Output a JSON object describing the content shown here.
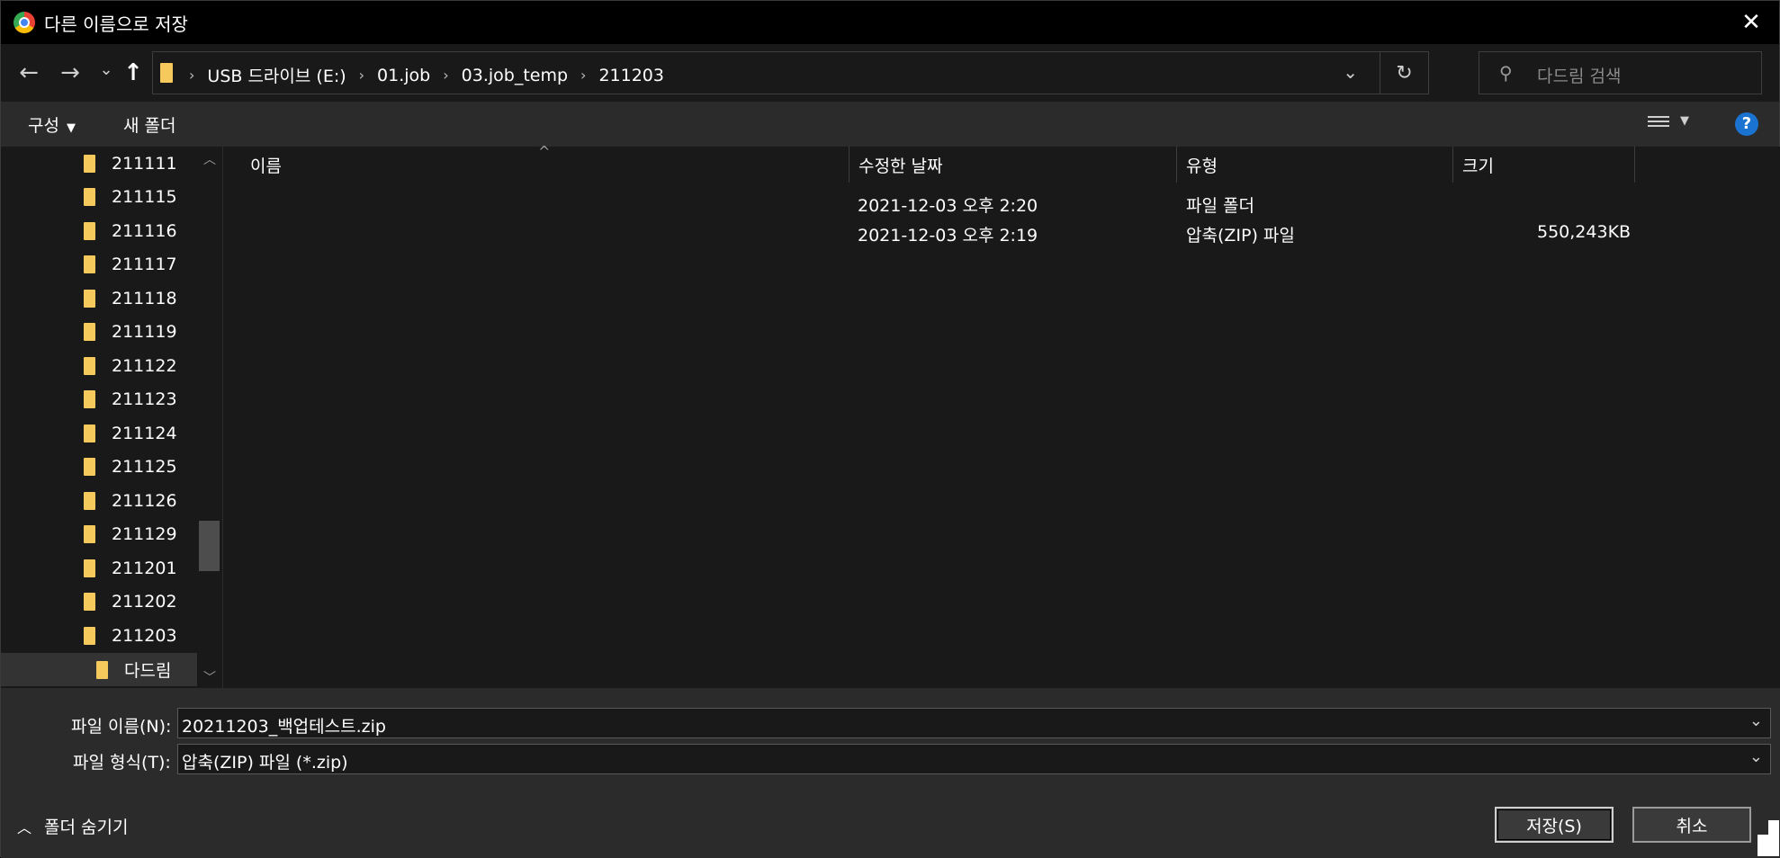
{
  "window": {
    "title": "다른 이름으로 저장",
    "close_glyph": "✕"
  },
  "nav": {
    "back_glyph": "←",
    "forward_glyph": "→",
    "recent_glyph": "⌄",
    "up_glyph": "↑",
    "breadcrumbs": [
      "USB 드라이브 (E:)",
      "01.job",
      "03.job_temp",
      "211203"
    ],
    "separator": "›",
    "dropdown_glyph": "⌄",
    "refresh_glyph": "↻",
    "search_placeholder": "다드림 검색"
  },
  "toolbar": {
    "organize_label": "구성",
    "new_folder_label": "새 폴더",
    "help_label": "?"
  },
  "sidebar": {
    "items": [
      {
        "label": "211111"
      },
      {
        "label": "211115"
      },
      {
        "label": "211116"
      },
      {
        "label": "211117"
      },
      {
        "label": "211118"
      },
      {
        "label": "211119"
      },
      {
        "label": "211122"
      },
      {
        "label": "211123"
      },
      {
        "label": "211124"
      },
      {
        "label": "211125"
      },
      {
        "label": "211126"
      },
      {
        "label": "211129"
      },
      {
        "label": "211201"
      },
      {
        "label": "211202"
      },
      {
        "label": "211203"
      },
      {
        "label": "다드림"
      }
    ],
    "selected_label": "다드림"
  },
  "files": {
    "columns": {
      "name": "이름",
      "modified": "수정한 날짜",
      "type": "유형",
      "size": "크기"
    },
    "rows": [
      {
        "name": "",
        "modified": "2021-12-03 오후 2:20",
        "type": "파일 폴더",
        "size": ""
      },
      {
        "name": "",
        "modified": "2021-12-03 오후 2:19",
        "type": "압축(ZIP) 파일",
        "size": "550,243KB"
      }
    ]
  },
  "bottom": {
    "filename_label": "파일 이름(N):",
    "filename_value": "20211203_백업테스트.zip",
    "filetype_label": "파일 형식(T):",
    "filetype_value": "압축(ZIP) 파일 (*.zip)",
    "hide_folders_label": "폴더 숨기기",
    "save_label": "저장(S)",
    "cancel_label": "취소"
  },
  "colors": {
    "background": "#191919",
    "toolbar": "#2b2b2b",
    "folder": "#f6c95c",
    "help_blue": "#1a73d1"
  }
}
